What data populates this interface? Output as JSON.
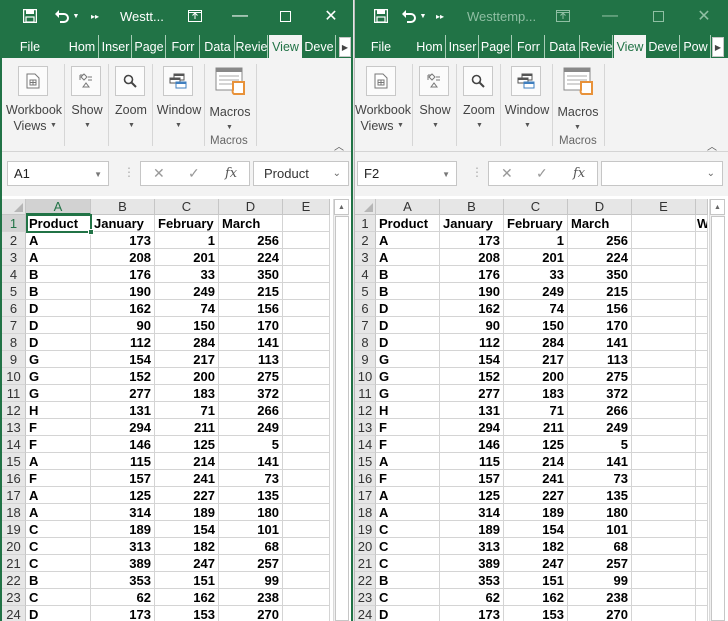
{
  "windows": [
    {
      "title": "Westt...",
      "active": true,
      "tabs": [
        "File",
        "Hom",
        "Inser",
        "Page",
        "Forr",
        "Data",
        "Revie",
        "View",
        "Deve"
      ],
      "active_tab": "View",
      "ribbon": {
        "buttons": [
          {
            "label1": "Workbook",
            "label2": "Views",
            "icon": "workbook-views-icon"
          },
          {
            "label1": "Show",
            "label2": "",
            "icon": "show-icon"
          },
          {
            "label1": "Zoom",
            "label2": "",
            "icon": "zoom-icon"
          },
          {
            "label1": "Window",
            "label2": "",
            "icon": "window-icon"
          },
          {
            "label1": "Macros",
            "label2": "",
            "icon": "macros-icon"
          }
        ],
        "group_label": "Macros"
      },
      "name_box": "A1",
      "formula": "Product",
      "selected_cell": "A1"
    },
    {
      "title": "Westtemp...",
      "active": false,
      "tabs": [
        "File",
        "Hom",
        "Inser",
        "Page",
        "Forr",
        "Data",
        "Revie",
        "View",
        "Deve",
        "Pow"
      ],
      "active_tab": "View",
      "ribbon": {
        "buttons": [
          {
            "label1": "Workbook",
            "label2": "Views",
            "icon": "workbook-views-icon"
          },
          {
            "label1": "Show",
            "label2": "",
            "icon": "show-icon"
          },
          {
            "label1": "Zoom",
            "label2": "",
            "icon": "zoom-icon"
          },
          {
            "label1": "Window",
            "label2": "",
            "icon": "window-icon"
          },
          {
            "label1": "Macros",
            "label2": "",
            "icon": "macros-icon"
          }
        ],
        "group_label": "Macros"
      },
      "name_box": "F2",
      "formula": "",
      "selected_cell": "F2",
      "extra_cell_f1": "W"
    }
  ],
  "sheet": {
    "columns_left": [
      "A",
      "B",
      "C",
      "D",
      "E"
    ],
    "columns_right": [
      "A",
      "B",
      "C",
      "D",
      "E"
    ],
    "header_row": [
      "Product",
      "January",
      "February",
      "March"
    ],
    "rows": [
      [
        "A",
        173,
        1,
        256
      ],
      [
        "A",
        208,
        201,
        224
      ],
      [
        "B",
        176,
        33,
        350
      ],
      [
        "B",
        190,
        249,
        215
      ],
      [
        "D",
        162,
        74,
        156
      ],
      [
        "D",
        90,
        150,
        170
      ],
      [
        "D",
        112,
        284,
        141
      ],
      [
        "G",
        154,
        217,
        113
      ],
      [
        "G",
        152,
        200,
        275
      ],
      [
        "G",
        277,
        183,
        372
      ],
      [
        "H",
        131,
        71,
        266
      ],
      [
        "F",
        294,
        211,
        249
      ],
      [
        "F",
        146,
        125,
        5
      ],
      [
        "A",
        115,
        214,
        141
      ],
      [
        "F",
        157,
        241,
        73
      ],
      [
        "A",
        125,
        227,
        135
      ],
      [
        "A",
        314,
        189,
        180
      ],
      [
        "C",
        189,
        154,
        101
      ],
      [
        "C",
        313,
        182,
        68
      ],
      [
        "C",
        389,
        247,
        257
      ],
      [
        "B",
        353,
        151,
        99
      ],
      [
        "C",
        62,
        162,
        238
      ],
      [
        "D",
        173,
        153,
        270
      ]
    ]
  },
  "colors": {
    "excel_green": "#217346",
    "ribbon_bg": "#f3f3f3",
    "macro_accent": "#e8923a",
    "window_icon_blue": "#3f7fbf"
  }
}
